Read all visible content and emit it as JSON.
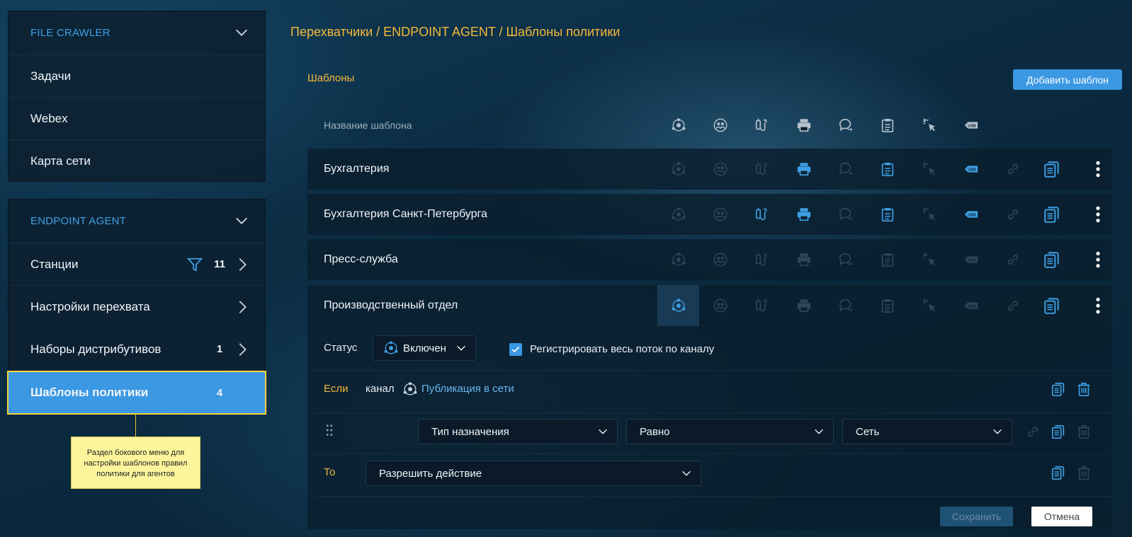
{
  "sidebar": {
    "file_crawler": {
      "title": "FILE CRAWLER",
      "items": [
        {
          "label": "Задачи"
        },
        {
          "label": "Webex"
        },
        {
          "label": "Карта сети"
        }
      ]
    },
    "endpoint_agent": {
      "title": "ENDPOINT AGENT",
      "items": [
        {
          "label": "Станции",
          "count": "11"
        },
        {
          "label": "Настройки перехвата"
        },
        {
          "label": "Наборы дистрибутивов",
          "count": "1"
        },
        {
          "label": "Шаблоны политики",
          "count": "4"
        }
      ]
    },
    "note": "Раздел бокового меню для настройки шаблонов правил политики для агентов"
  },
  "breadcrumb": "Перехватчики / ENDPOINT AGENT / Шаблоны политики",
  "section_title": "Шаблоны",
  "add_button": "Добавить шаблон",
  "table": {
    "header_name": "Название шаблона",
    "channel_icons": [
      "network-publish-icon",
      "im-icon",
      "removable-device-icon",
      "printer-icon",
      "chat-icon",
      "clipboard-icon",
      "screenshot-icon",
      "usb-icon"
    ],
    "rows": [
      {
        "name": "Бухгалтерия"
      },
      {
        "name": "Бухгалтерия Санкт-Петербурга"
      },
      {
        "name": "Пресс-служба"
      },
      {
        "name": "Производственный отдел"
      }
    ]
  },
  "editor": {
    "status_label": "Статус",
    "status_value": "Включен",
    "checkbox_label": "Регистрировать весь поток по каналу",
    "if_label": "Если",
    "channel_label": "канал",
    "channel_value": "Публикация в сети",
    "condition": {
      "field": "Тип назначения",
      "operator": "Равно",
      "value": "Сеть"
    },
    "then_label": "То",
    "action": "Разрешить действие",
    "save": "Сохранить",
    "cancel": "Отмена"
  },
  "colors": {
    "accent": "#3b98e3",
    "highlight": "#f5b83a",
    "note_bg": "#fdf59c"
  }
}
